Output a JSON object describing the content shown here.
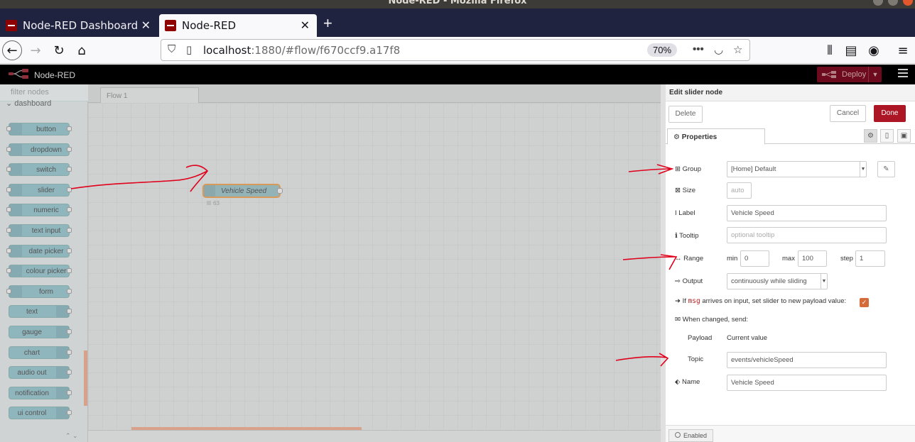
{
  "window": {
    "title": "Node-RED - Mozilla Firefox"
  },
  "browser": {
    "tabs": [
      {
        "label": "Node-RED Dashboard",
        "active": false
      },
      {
        "label": "Node-RED",
        "active": true
      }
    ],
    "url_host": "localhost",
    "url_rest": ":1880/#flow/f670ccf9.a17f8",
    "zoom": "70%"
  },
  "nodered": {
    "title": "Node-RED",
    "deploy_label": "Deploy",
    "palette": {
      "filter_placeholder": "filter nodes",
      "category": "dashboard",
      "nodes": [
        "button",
        "dropdown",
        "switch",
        "slider",
        "numeric",
        "text input",
        "date picker",
        "colour picker",
        "form",
        "text",
        "gauge",
        "chart",
        "audio out",
        "notification",
        "ui control"
      ]
    },
    "workspace": {
      "flow_tab": "Flow 1",
      "node_label": "Vehicle Speed",
      "node_status": "63"
    }
  },
  "tray": {
    "title": "Edit slider node",
    "delete": "Delete",
    "cancel": "Cancel",
    "done": "Done",
    "properties_tab": "Properties",
    "group_label": "Group",
    "group_value": "[Home] Default",
    "size_label": "Size",
    "size_value": "auto",
    "label_label": "Label",
    "label_value": "Vehicle Speed",
    "tooltip_label": "Tooltip",
    "tooltip_placeholder": "optional tooltip",
    "range_label": "Range",
    "min_label": "min",
    "min_value": "0",
    "max_label": "max",
    "max_value": "100",
    "step_label": "step",
    "step_value": "1",
    "output_label": "Output",
    "output_value": "continuously while sliding",
    "if_text": "If",
    "msg_text": "msg",
    "arrives_text": "arrives on input, set slider to new payload value:",
    "when_changed": "When changed, send:",
    "payload_label": "Payload",
    "payload_value": "Current value",
    "topic_label": "Topic",
    "topic_value": "events/vehicleSpeed",
    "name_label": "Name",
    "name_value": "Vehicle Speed",
    "enabled": "Enabled"
  },
  "colors": {
    "annotation": "#e0001b",
    "done": "#ad1625",
    "deploy": "#6e0a1e"
  }
}
